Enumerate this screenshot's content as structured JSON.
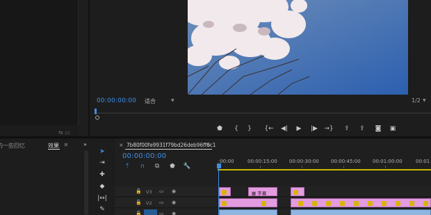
{
  "program_monitor": {
    "timecode": "00:00:00:00",
    "fit": "适合",
    "resolution": "1/2",
    "controls": [
      "add-marker",
      "mark-in",
      "mark-out",
      "go-to-in",
      "step-back",
      "play",
      "step-forward",
      "go-to-out",
      "lift",
      "extract",
      "export-frame",
      "compare-view"
    ]
  },
  "effects_panel": {
    "history_tab": "我的一些回忆",
    "effects_tab": "效果",
    "tab_menu": "≡",
    "more": "»"
  },
  "tools": [
    "selection",
    "track-select",
    "ripple-edit",
    "razor",
    "slip",
    "pen"
  ],
  "timeline": {
    "close": "×",
    "sequence_name": "7b80f00fe9931f79bd26deb96ff6c1",
    "tab_menu": "≡",
    "timecode": "00:00:00:00",
    "ruler_labels": [
      ":00:00",
      "00:00:15:00",
      "00:00:30:00",
      "00:00:45:00",
      "00:01:00:00",
      "00:01"
    ],
    "tracks": [
      {
        "name": "V3"
      },
      {
        "name": "V2"
      },
      {
        "name": "V1"
      }
    ],
    "clip_title": "字幕"
  },
  "colors": {
    "timecode_blue": "#3f8fe6",
    "clip_pink": "#e39ce0",
    "workarea_yellow": "#c9b700",
    "clip_blue": "#8fb5e0"
  }
}
